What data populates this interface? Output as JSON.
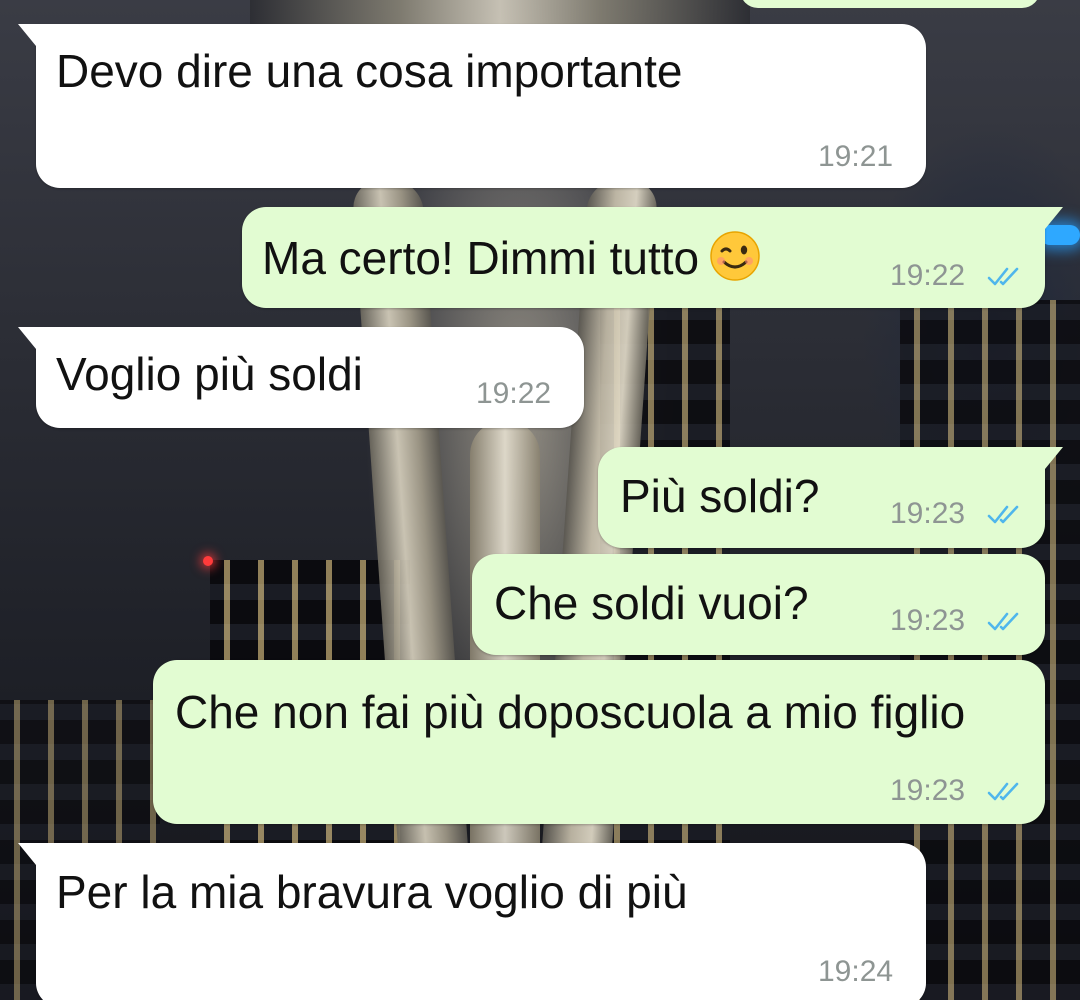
{
  "messages": [
    {
      "direction": "incoming",
      "text": "Devo dire una cosa importante",
      "time": "19:21"
    },
    {
      "direction": "outgoing",
      "text": "Ma certo! Dimmi tutto",
      "emoji": "winking-face-emoji",
      "time": "19:22",
      "status": "read"
    },
    {
      "direction": "incoming",
      "text": "Voglio più soldi",
      "time": "19:22"
    },
    {
      "direction": "outgoing",
      "text": "Più soldi?",
      "time": "19:23",
      "status": "read"
    },
    {
      "direction": "outgoing",
      "text": "Che soldi vuoi?",
      "time": "19:23",
      "status": "read"
    },
    {
      "direction": "outgoing",
      "text": "Che non fai più doposcuola a mio figlio",
      "time": "19:23",
      "status": "read"
    },
    {
      "direction": "incoming",
      "text": "Per la mia bravura voglio di più",
      "time": "19:24"
    }
  ],
  "colors": {
    "incoming_bubble": "#ffffff",
    "outgoing_bubble": "#e2fcd2",
    "read_ticks": "#4fb6ec",
    "timestamp": "#8e9593"
  },
  "icons": {
    "read_status": "double-check-icon"
  }
}
